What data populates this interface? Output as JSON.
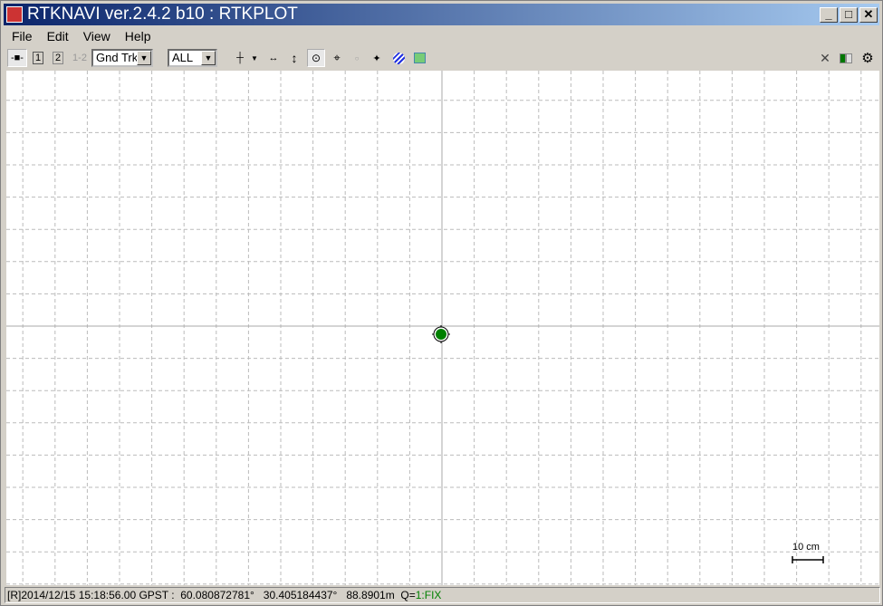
{
  "window": {
    "title": "RTKNAVI ver.2.4.2 b10 : RTKPLOT",
    "minimize": "_",
    "maximize": "□",
    "close": "✕"
  },
  "menu": [
    "File",
    "Edit",
    "View",
    "Help"
  ],
  "toolbar": {
    "btn1": "1",
    "btn2": "2",
    "btn12": "1-2",
    "plot_type": "Gnd Trk",
    "sat_select": "ALL"
  },
  "plot": {
    "scale_label": "10 cm",
    "marker_color": "#008000",
    "fix_color": "#008000"
  },
  "status": {
    "prefix": "[R]2014/12/15 15:18:56.00 GPST :  60.080872781°   30.405184437°   88.8901m  Q=",
    "quality": "1:FIX"
  }
}
